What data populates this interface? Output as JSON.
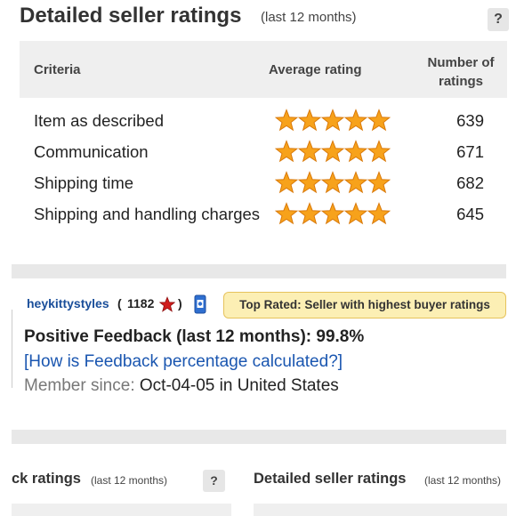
{
  "top": {
    "title": "Detailed seller ratings",
    "subtitle": "(last 12 months)",
    "help_label": "?"
  },
  "table": {
    "headers": {
      "criteria": "Criteria",
      "average": "Average rating",
      "number": "Number of ratings"
    },
    "rows": [
      {
        "criteria": "Item as described",
        "stars": 5,
        "count": "639"
      },
      {
        "criteria": "Communication",
        "stars": 5,
        "count": "671"
      },
      {
        "criteria": "Shipping time",
        "stars": 5,
        "count": "682"
      },
      {
        "criteria": "Shipping and handling charges",
        "stars": 5,
        "count": "645"
      }
    ]
  },
  "seller": {
    "username": "heykittystyles",
    "open_paren": "(",
    "score": "1182",
    "close_paren": ")",
    "star_color": "#d01c1c",
    "top_rated": "Top Rated: Seller with highest buyer ratings",
    "positive_feedback": "Positive Feedback (last 12 months): 99.8%",
    "how_link": "[How is Feedback percentage calculated?]",
    "member_label": "Member since:",
    "member_value": "Oct-04-05 in United States"
  },
  "bottom": {
    "left_title": "ck ratings",
    "left_subtitle": "(last 12 months)",
    "left_help": "?",
    "right_title": "Detailed seller ratings",
    "right_subtitle": "(last 12 months)"
  },
  "colors": {
    "star_fill": "#f7a21b",
    "star_stroke": "#d9790a",
    "link": "#1a56b0",
    "badge_bg": "#fcefb4"
  },
  "icons": {
    "rating_star": "star-icon",
    "seller_star": "red-star-icon",
    "badge": "top-rated-badge-icon",
    "help": "question-mark-icon"
  }
}
